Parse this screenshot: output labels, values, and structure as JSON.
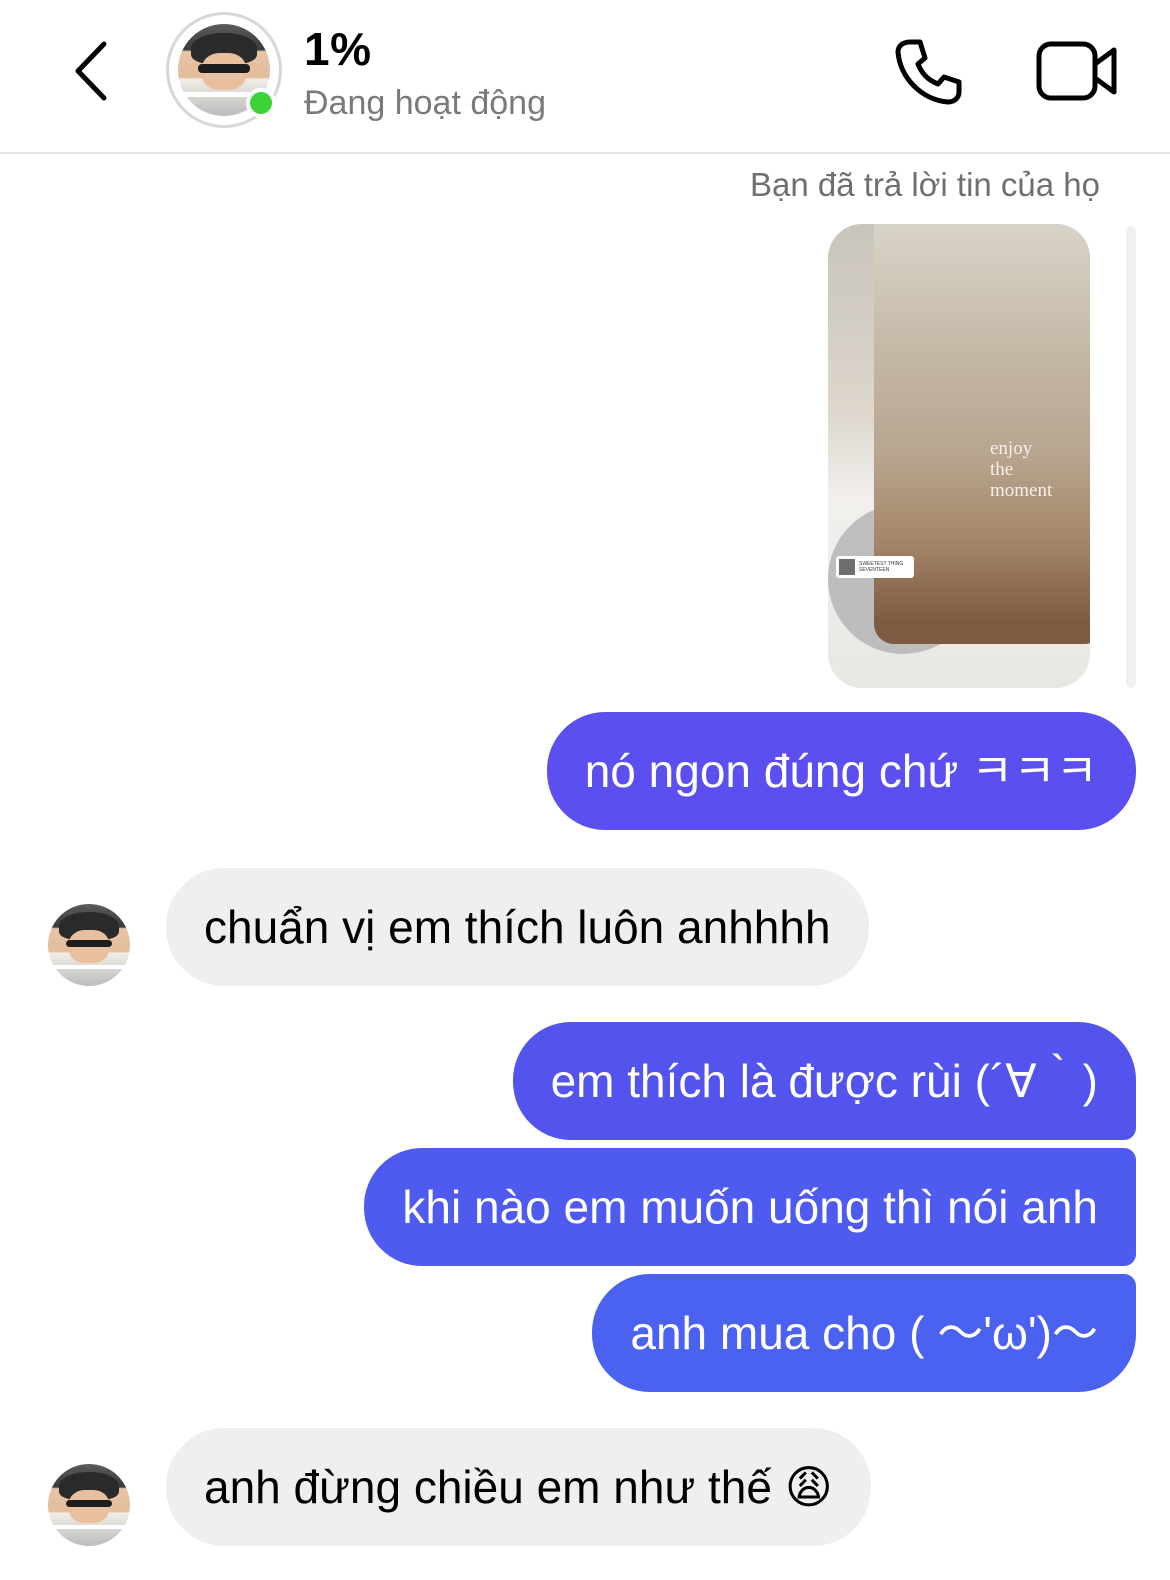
{
  "header": {
    "contact_name": "1%",
    "status": "Đang hoạt động",
    "back_icon": "chevron-left-icon",
    "call_icon": "phone-icon",
    "video_icon": "video-camera-icon",
    "online_color": "#3cd339"
  },
  "story_reply": {
    "note": "Bạn đã trả lời tin của họ",
    "image_caption": "enjoy\nthe\nmoment",
    "music_title": "SWEETEST THING",
    "music_artist": "SEVENTEEN"
  },
  "messages": [
    {
      "from": "me",
      "text": "nó ngon đúng chứ ㅋㅋㅋ",
      "color": "#5b4ff0"
    },
    {
      "from": "them",
      "text": "chuẩn vị em thích luôn anhhhh"
    },
    {
      "from": "me",
      "text": "em thích là được rùi (´∀｀)",
      "color": "#5354ee"
    },
    {
      "from": "me",
      "text": "khi nào em muốn uống thì nói anh",
      "color": "#4f5bee"
    },
    {
      "from": "me",
      "text": "anh mua cho ( ～'ω')～",
      "color": "#4a62ef"
    },
    {
      "from": "them",
      "text": "anh đừng chiều em như thế 😩"
    }
  ],
  "colors": {
    "incoming_bubble": "#efefef",
    "outgoing_bubble_gradient": [
      "#5b4ff0",
      "#4a62ef"
    ]
  }
}
